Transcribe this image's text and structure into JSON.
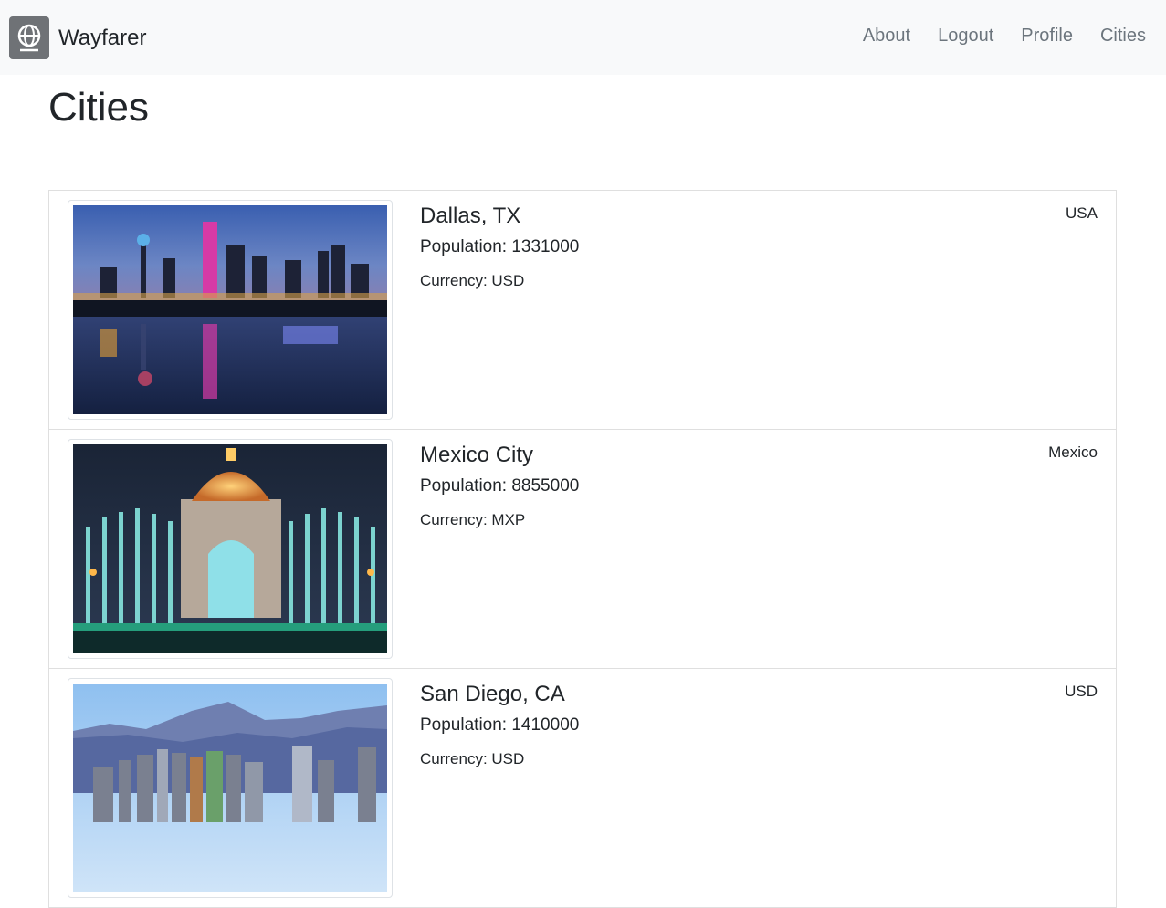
{
  "brand": {
    "name": "Wayfarer",
    "logo_icon": "globe-icon"
  },
  "nav": {
    "links": [
      "About",
      "Logout",
      "Profile",
      "Cities"
    ]
  },
  "page": {
    "title": "Cities"
  },
  "cities": [
    {
      "name": "Dallas, TX",
      "population": "Population: 1331000",
      "currency": "Currency: USD",
      "country": "USA",
      "image": "dallas-skyline-night-image"
    },
    {
      "name": "Mexico City",
      "population": "Population: 8855000",
      "currency": "Currency: MXP",
      "country": "Mexico",
      "image": "mexico-city-monument-fountains-image"
    },
    {
      "name": "San Diego, CA",
      "population": "Population: 1410000",
      "currency": "Currency: USD",
      "country": "USD",
      "image": "san-diego-skyline-mountains-image"
    }
  ],
  "colors": {
    "navbar_bg": "#f8f9fa",
    "nav_link": "#6c757d",
    "text": "#212529",
    "border": "#dfdfdf",
    "logo_bg": "#6f7276"
  }
}
